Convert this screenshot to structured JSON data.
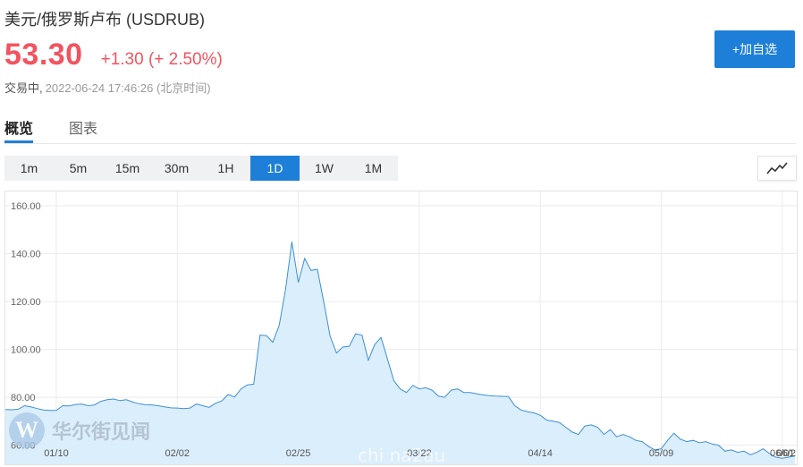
{
  "header": {
    "title": "美元/俄罗斯卢布 (USDRUB)",
    "price": "53.30",
    "change": "+1.30 (+ 2.50%)",
    "status": "交易中,",
    "time": "2022-06-24 17:46:26 (北京时间)",
    "add_button": "+加自选",
    "price_color": "#f2535f",
    "accent_color": "#1e7fd9"
  },
  "tabs": [
    {
      "label": "概览",
      "active": true
    },
    {
      "label": "图表",
      "active": false
    }
  ],
  "periods": [
    {
      "label": "1m",
      "active": false
    },
    {
      "label": "5m",
      "active": false
    },
    {
      "label": "15m",
      "active": false
    },
    {
      "label": "30m",
      "active": false
    },
    {
      "label": "1H",
      "active": false
    },
    {
      "label": "1D",
      "active": true
    },
    {
      "label": "1W",
      "active": false
    },
    {
      "label": "1M",
      "active": false
    }
  ],
  "chart_type_icon": "line-chart-icon",
  "watermark": {
    "logo_letter": "W",
    "text": "华尔街见闻",
    "site": "chi na2au"
  },
  "chart_data": {
    "type": "area",
    "title": "",
    "xlabel": "",
    "ylabel": "",
    "ylim": [
      52,
      166
    ],
    "y_ticks": [
      "160.00",
      "140.00",
      "120.00",
      "100.00",
      "80.00",
      "60.00"
    ],
    "y_tick_values": [
      160,
      140,
      120,
      100,
      80,
      60
    ],
    "x_ticks": [
      "01/10",
      "02/02",
      "02/25",
      "03/22",
      "04/14",
      "05/09",
      "06/01",
      "06/2"
    ],
    "x_tick_index": [
      8,
      27,
      46,
      65,
      84,
      103,
      122,
      141
    ],
    "grid": true,
    "line_color": "#3d8fd6",
    "fill_color": "#dbeefc",
    "series": [
      {
        "values": [
          74.9,
          74.8,
          75.0,
          76.5,
          76.0,
          75.3,
          74.7,
          74.5,
          74.5,
          76.5,
          76.4,
          77.0,
          77.2,
          76.5,
          76.8,
          78.3,
          79.0,
          79.3,
          78.6,
          79.0,
          78.0,
          77.3,
          76.9,
          76.8,
          76.5,
          76.0,
          75.6,
          75.5,
          75.3,
          75.5,
          77.2,
          76.5,
          75.8,
          77.5,
          78.5,
          81.2,
          80.1,
          83.5,
          85.2,
          85.5,
          106.0,
          105.8,
          103.0,
          110.0,
          125.0,
          145.0,
          128.0,
          138.0,
          133.0,
          133.5,
          120.0,
          105.5,
          98.5,
          101.0,
          101.3,
          106.5,
          106.0,
          95.5,
          102.0,
          105.0,
          96.0,
          87.0,
          83.5,
          82.0,
          85.0,
          83.5,
          84.0,
          83.0,
          80.5,
          80.0,
          83.0,
          83.5,
          82.0,
          82.0,
          81.5,
          81.0,
          80.7,
          80.5,
          80.4,
          80.3,
          76.5,
          74.7,
          74.0,
          73.5,
          72.5,
          70.5,
          70.0,
          69.5,
          67.5,
          65.5,
          64.5,
          68.0,
          68.5,
          67.5,
          64.5,
          66.5,
          63.5,
          64.5,
          63.5,
          62.0,
          61.5,
          59.5,
          58.0,
          58.5,
          62.0,
          65.0,
          62.5,
          61.5,
          62.0,
          61.0,
          61.5,
          60.5,
          60.0,
          57.5,
          58.0,
          57.0,
          57.5,
          56.0,
          57.0,
          58.5,
          56.5,
          55.0,
          54.5,
          55.0,
          55.5
        ]
      }
    ]
  }
}
